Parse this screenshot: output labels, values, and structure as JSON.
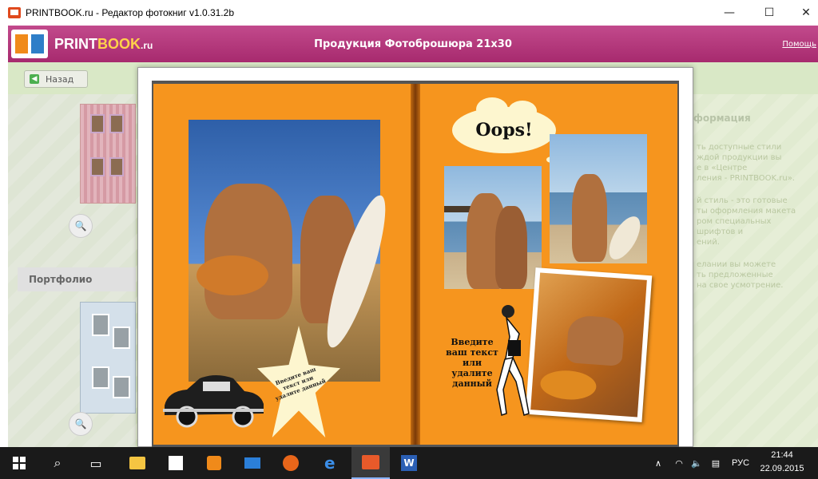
{
  "window": {
    "title": "PRINTBOOK.ru - Редактор фотокниг v1.0.31.2b",
    "minimize": "—",
    "maximize": "☐",
    "close": "✕"
  },
  "header": {
    "logo_print": "PRINT",
    "logo_book": "BOOK",
    "logo_ru": ".ru",
    "title": "Продукция Фотоброшюра 21х30",
    "help": "Помощь"
  },
  "nav": {
    "back_label": "Назад"
  },
  "left": {
    "portfolio_label": "Портфолио"
  },
  "right": {
    "heading": "формация",
    "lines": [
      "ть доступные стили",
      "ждой продукции вы",
      "е в «Центре",
      "ления - PRINTBOOK.ru».",
      "",
      "й стиль - это готовые",
      "ты оформления макета",
      "ром специальных",
      "шрифтов и",
      "ений.",
      "",
      "елании вы можете",
      "ть предложенные",
      "на свое усмотрение."
    ]
  },
  "spread": {
    "oops": "Oops!",
    "star_text": "Введите ваш текст или удалите данный",
    "right_text": "Введите ваш текст или удалите данный"
  },
  "taskbar": {
    "lang": "РУС",
    "time": "21:44",
    "date": "22.09.2015"
  }
}
